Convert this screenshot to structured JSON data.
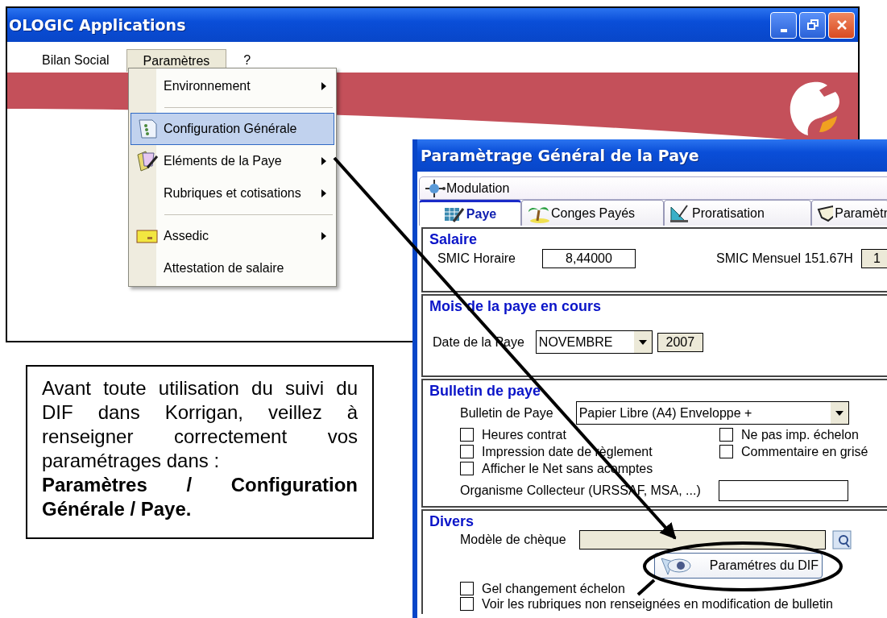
{
  "window": {
    "title": "OLOGIC Applications"
  },
  "menu_bar": [
    {
      "label": "Bilan Social",
      "selected": false
    },
    {
      "label": "Paramètres",
      "selected": true
    },
    {
      "label": "?",
      "selected": false
    }
  ],
  "menu": [
    {
      "kind": "item",
      "label": "Environnement",
      "submenu": true,
      "selected": false
    },
    {
      "kind": "separator"
    },
    {
      "kind": "item",
      "label": "Configuration Générale",
      "submenu": false,
      "selected": true
    },
    {
      "kind": "item",
      "label": "Eléments de la Paye",
      "submenu": true,
      "selected": false
    },
    {
      "kind": "item",
      "label": "Rubriques et cotisations",
      "submenu": true,
      "selected": false
    },
    {
      "kind": "separator"
    },
    {
      "kind": "item",
      "label": "Assedic",
      "submenu": true,
      "selected": false
    },
    {
      "kind": "item",
      "label": "Attestation de salaire",
      "submenu": false,
      "selected": false
    }
  ],
  "dialog": {
    "title": "Paramètrage Général de la Paye",
    "top_tab": "Modulation",
    "tabs": [
      {
        "label": "Paye",
        "selected": true
      },
      {
        "label": "Conges Payés",
        "selected": false
      },
      {
        "label": "Proratisation",
        "selected": false
      },
      {
        "label": "Paramètr",
        "selected": false
      }
    ],
    "salaire": {
      "title": "Salaire",
      "fields": [
        {
          "label": "SMIC Horaire",
          "value": "8,44000",
          "disabled": false
        },
        {
          "label": "SMIC Mensuel 151.67H",
          "value": "1",
          "disabled": true
        }
      ]
    },
    "mois": {
      "title": "Mois de la paye en cours",
      "label": "Date de la Paye",
      "month": "NOVEMBRE",
      "year": "2007"
    },
    "bulletin": {
      "title": "Bulletin de paye",
      "select_label": "Bulletin de Paye",
      "select_value": "Papier Libre (A4) Enveloppe +",
      "left_options": [
        {
          "label": "Heures contrat",
          "checked": false
        },
        {
          "label": "Impression date de règlement",
          "checked": false
        },
        {
          "label": "Afficher le Net sans acomptes",
          "checked": false
        }
      ],
      "right_options": [
        {
          "label": "Ne pas imp. échelon",
          "checked": false
        },
        {
          "label": "Commentaire en grisé",
          "checked": false
        }
      ],
      "collector_label": "Organisme Collecteur (URSSAF, MSA, ...)"
    },
    "divers": {
      "title": "Divers",
      "cheque_label": "Modèle de chèque",
      "dif_button": "Paramétres du DIF",
      "options": [
        {
          "label": "Gel changement échelon",
          "checked": false
        },
        {
          "label": "Voir les rubriques non renseignées en modification de bulletin",
          "checked": false
        }
      ]
    }
  },
  "note": {
    "text": "Avant toute utilisation du suivi du DIF dans Korrigan, veillez à renseigner correctement vos paramétrages dans :",
    "path": "Paramètres / Configuration Générale / Paye."
  }
}
